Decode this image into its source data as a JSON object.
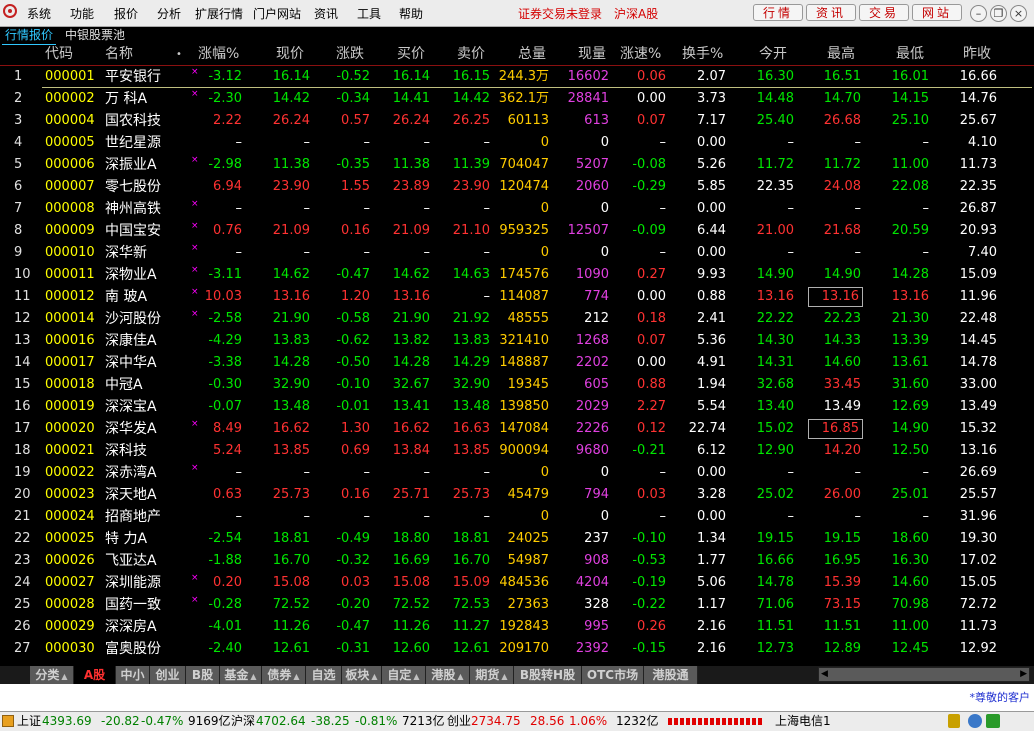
{
  "menubar": {
    "items": [
      "系统",
      "功能",
      "报价",
      "分析",
      "扩展行情",
      "门户网站",
      "资讯",
      "工具",
      "帮助"
    ],
    "status_text": "证券交易未登录",
    "market_text": "沪深A股",
    "buttons": [
      "行情",
      "资讯",
      "交易",
      "网站"
    ],
    "window_controls": [
      "minimize-icon",
      "restore-icon",
      "close-icon"
    ]
  },
  "top_tabs": [
    "行情报价",
    "中银股票池"
  ],
  "columns": [
    "代码",
    "名称",
    "•",
    "涨幅%",
    "现价",
    "涨跌",
    "买价",
    "卖价",
    "总量",
    "现量",
    "涨速%",
    "换手%",
    "今开",
    "最高",
    "最低",
    "昨收"
  ],
  "colors": {
    "up": "#ff3232",
    "down": "#00e600",
    "flat": "#ffffff",
    "code": "#ffff00",
    "volume": "#ffcc00",
    "current_vol": "#e040e0",
    "marker": "#ff00ff"
  },
  "rows": [
    {
      "i": "1",
      "code": "000001",
      "name": "平安银行",
      "m": true,
      "chg": "-3.12",
      "price": "16.14",
      "diff": "-0.52",
      "bid": "16.14",
      "ask": "16.15",
      "vol": "244.3万",
      "cur": "16602",
      "spd": "0.06",
      "turn": "2.07",
      "open": "16.30",
      "high": "16.51",
      "low": "16.01",
      "prev": "16.66"
    },
    {
      "i": "2",
      "code": "000002",
      "name": "万  科A",
      "m": true,
      "chg": "-2.30",
      "price": "14.42",
      "diff": "-0.34",
      "bid": "14.41",
      "ask": "14.42",
      "vol": "362.1万",
      "cur": "28841",
      "spd": "0.00",
      "turn": "3.73",
      "open": "14.48",
      "high": "14.70",
      "low": "14.15",
      "prev": "14.76"
    },
    {
      "i": "3",
      "code": "000004",
      "name": "国农科技",
      "m": false,
      "chg": "2.22",
      "price": "26.24",
      "diff": "0.57",
      "bid": "26.24",
      "ask": "26.25",
      "vol": "60113",
      "cur": "613",
      "spd": "0.07",
      "turn": "7.17",
      "open": "25.40",
      "high": "26.68",
      "low": "25.10",
      "prev": "25.67"
    },
    {
      "i": "4",
      "code": "000005",
      "name": "世纪星源",
      "m": false,
      "chg": "–",
      "price": "–",
      "diff": "–",
      "bid": "–",
      "ask": "–",
      "vol": "0",
      "cur": "0",
      "spd": "–",
      "turn": "0.00",
      "open": "–",
      "high": "–",
      "low": "–",
      "prev": "4.10"
    },
    {
      "i": "5",
      "code": "000006",
      "name": "深振业A",
      "m": true,
      "chg": "-2.98",
      "price": "11.38",
      "diff": "-0.35",
      "bid": "11.38",
      "ask": "11.39",
      "vol": "704047",
      "cur": "5207",
      "spd": "-0.08",
      "turn": "5.26",
      "open": "11.72",
      "high": "11.72",
      "low": "11.00",
      "prev": "11.73"
    },
    {
      "i": "6",
      "code": "000007",
      "name": "零七股份",
      "m": false,
      "chg": "6.94",
      "price": "23.90",
      "diff": "1.55",
      "bid": "23.89",
      "ask": "23.90",
      "vol": "120474",
      "cur": "2060",
      "spd": "-0.29",
      "turn": "5.85",
      "open": "22.35",
      "high": "24.08",
      "low": "22.08",
      "prev": "22.35"
    },
    {
      "i": "7",
      "code": "000008",
      "name": "神州高铁",
      "m": true,
      "chg": "–",
      "price": "–",
      "diff": "–",
      "bid": "–",
      "ask": "–",
      "vol": "0",
      "cur": "0",
      "spd": "–",
      "turn": "0.00",
      "open": "–",
      "high": "–",
      "low": "–",
      "prev": "26.87"
    },
    {
      "i": "8",
      "code": "000009",
      "name": "中国宝安",
      "m": true,
      "chg": "0.76",
      "price": "21.09",
      "diff": "0.16",
      "bid": "21.09",
      "ask": "21.10",
      "vol": "959325",
      "cur": "12507",
      "spd": "-0.09",
      "turn": "6.44",
      "open": "21.00",
      "high": "21.68",
      "low": "20.59",
      "prev": "20.93"
    },
    {
      "i": "9",
      "code": "000010",
      "name": "深华新",
      "m": true,
      "chg": "–",
      "price": "–",
      "diff": "–",
      "bid": "–",
      "ask": "–",
      "vol": "0",
      "cur": "0",
      "spd": "–",
      "turn": "0.00",
      "open": "–",
      "high": "–",
      "low": "–",
      "prev": "7.40"
    },
    {
      "i": "10",
      "code": "000011",
      "name": "深物业A",
      "m": true,
      "chg": "-3.11",
      "price": "14.62",
      "diff": "-0.47",
      "bid": "14.62",
      "ask": "14.63",
      "vol": "174576",
      "cur": "1090",
      "spd": "0.27",
      "turn": "9.93",
      "open": "14.90",
      "high": "14.90",
      "low": "14.28",
      "prev": "15.09"
    },
    {
      "i": "11",
      "code": "000012",
      "name": "南  玻A",
      "m": true,
      "chg": "10.03",
      "price": "13.16",
      "diff": "1.20",
      "bid": "13.16",
      "ask": "–",
      "vol": "114087",
      "cur": "774",
      "spd": "0.00",
      "turn": "0.88",
      "open": "13.16",
      "high": "13.16",
      "low": "13.16",
      "prev": "11.96"
    },
    {
      "i": "12",
      "code": "000014",
      "name": "沙河股份",
      "m": true,
      "chg": "-2.58",
      "price": "21.90",
      "diff": "-0.58",
      "bid": "21.90",
      "ask": "21.92",
      "vol": "48555",
      "cur": "212",
      "spd": "0.18",
      "turn": "2.41",
      "open": "22.22",
      "high": "22.23",
      "low": "21.30",
      "prev": "22.48"
    },
    {
      "i": "13",
      "code": "000016",
      "name": "深康佳A",
      "m": false,
      "chg": "-4.29",
      "price": "13.83",
      "diff": "-0.62",
      "bid": "13.82",
      "ask": "13.83",
      "vol": "321410",
      "cur": "1268",
      "spd": "0.07",
      "turn": "5.36",
      "open": "14.30",
      "high": "14.33",
      "low": "13.39",
      "prev": "14.45"
    },
    {
      "i": "14",
      "code": "000017",
      "name": "深中华A",
      "m": false,
      "chg": "-3.38",
      "price": "14.28",
      "diff": "-0.50",
      "bid": "14.28",
      "ask": "14.29",
      "vol": "148887",
      "cur": "2202",
      "spd": "0.00",
      "turn": "4.91",
      "open": "14.31",
      "high": "14.60",
      "low": "13.61",
      "prev": "14.78"
    },
    {
      "i": "15",
      "code": "000018",
      "name": "中冠A",
      "m": false,
      "chg": "-0.30",
      "price": "32.90",
      "diff": "-0.10",
      "bid": "32.67",
      "ask": "32.90",
      "vol": "19345",
      "cur": "605",
      "spd": "0.88",
      "turn": "1.94",
      "open": "32.68",
      "high": "33.45",
      "low": "31.60",
      "prev": "33.00"
    },
    {
      "i": "16",
      "code": "000019",
      "name": "深深宝A",
      "m": false,
      "chg": "-0.07",
      "price": "13.48",
      "diff": "-0.01",
      "bid": "13.41",
      "ask": "13.48",
      "vol": "139850",
      "cur": "2029",
      "spd": "2.27",
      "turn": "5.54",
      "open": "13.40",
      "high": "13.49",
      "low": "12.69",
      "prev": "13.49"
    },
    {
      "i": "17",
      "code": "000020",
      "name": "深华发A",
      "m": true,
      "chg": "8.49",
      "price": "16.62",
      "diff": "1.30",
      "bid": "16.62",
      "ask": "16.63",
      "vol": "147084",
      "cur": "2226",
      "spd": "0.12",
      "turn": "22.74",
      "open": "15.02",
      "high": "16.85",
      "low": "14.90",
      "prev": "15.32"
    },
    {
      "i": "18",
      "code": "000021",
      "name": "深科技",
      "m": false,
      "chg": "5.24",
      "price": "13.85",
      "diff": "0.69",
      "bid": "13.84",
      "ask": "13.85",
      "vol": "900094",
      "cur": "9680",
      "spd": "-0.21",
      "turn": "6.12",
      "open": "12.90",
      "high": "14.20",
      "low": "12.50",
      "prev": "13.16"
    },
    {
      "i": "19",
      "code": "000022",
      "name": "深赤湾A",
      "m": true,
      "chg": "–",
      "price": "–",
      "diff": "–",
      "bid": "–",
      "ask": "–",
      "vol": "0",
      "cur": "0",
      "spd": "–",
      "turn": "0.00",
      "open": "–",
      "high": "–",
      "low": "–",
      "prev": "26.69"
    },
    {
      "i": "20",
      "code": "000023",
      "name": "深天地A",
      "m": false,
      "chg": "0.63",
      "price": "25.73",
      "diff": "0.16",
      "bid": "25.71",
      "ask": "25.73",
      "vol": "45479",
      "cur": "794",
      "spd": "0.03",
      "turn": "3.28",
      "open": "25.02",
      "high": "26.00",
      "low": "25.01",
      "prev": "25.57"
    },
    {
      "i": "21",
      "code": "000024",
      "name": "招商地产",
      "m": false,
      "chg": "–",
      "price": "–",
      "diff": "–",
      "bid": "–",
      "ask": "–",
      "vol": "0",
      "cur": "0",
      "spd": "–",
      "turn": "0.00",
      "open": "–",
      "high": "–",
      "low": "–",
      "prev": "31.96"
    },
    {
      "i": "22",
      "code": "000025",
      "name": "特  力A",
      "m": false,
      "chg": "-2.54",
      "price": "18.81",
      "diff": "-0.49",
      "bid": "18.80",
      "ask": "18.81",
      "vol": "24025",
      "cur": "237",
      "spd": "-0.10",
      "turn": "1.34",
      "open": "19.15",
      "high": "19.15",
      "low": "18.60",
      "prev": "19.30"
    },
    {
      "i": "23",
      "code": "000026",
      "name": "飞亚达A",
      "m": false,
      "chg": "-1.88",
      "price": "16.70",
      "diff": "-0.32",
      "bid": "16.69",
      "ask": "16.70",
      "vol": "54987",
      "cur": "908",
      "spd": "-0.53",
      "turn": "1.77",
      "open": "16.66",
      "high": "16.95",
      "low": "16.30",
      "prev": "17.02"
    },
    {
      "i": "24",
      "code": "000027",
      "name": "深圳能源",
      "m": true,
      "chg": "0.20",
      "price": "15.08",
      "diff": "0.03",
      "bid": "15.08",
      "ask": "15.09",
      "vol": "484536",
      "cur": "4204",
      "spd": "-0.19",
      "turn": "5.06",
      "open": "14.78",
      "high": "15.39",
      "low": "14.60",
      "prev": "15.05"
    },
    {
      "i": "25",
      "code": "000028",
      "name": "国药一致",
      "m": true,
      "chg": "-0.28",
      "price": "72.52",
      "diff": "-0.20",
      "bid": "72.52",
      "ask": "72.53",
      "vol": "27363",
      "cur": "328",
      "spd": "-0.22",
      "turn": "1.17",
      "open": "71.06",
      "high": "73.15",
      "low": "70.98",
      "prev": "72.72"
    },
    {
      "i": "26",
      "code": "000029",
      "name": "深深房A",
      "m": false,
      "chg": "-4.01",
      "price": "11.26",
      "diff": "-0.47",
      "bid": "11.26",
      "ask": "11.27",
      "vol": "192843",
      "cur": "995",
      "spd": "0.26",
      "turn": "2.16",
      "open": "11.51",
      "high": "11.51",
      "low": "11.00",
      "prev": "11.73"
    },
    {
      "i": "27",
      "code": "000030",
      "name": "富奥股份",
      "m": false,
      "chg": "-2.40",
      "price": "12.61",
      "diff": "-0.31",
      "bid": "12.60",
      "ask": "12.61",
      "vol": "209170",
      "cur": "2392",
      "spd": "-0.15",
      "turn": "2.16",
      "open": "12.73",
      "high": "12.89",
      "low": "12.45",
      "prev": "12.92"
    }
  ],
  "bottom_tabs": [
    {
      "label": "分类",
      "arrow": true
    },
    {
      "label": "A股",
      "arrow": false,
      "active": true
    },
    {
      "label": "中小",
      "arrow": false
    },
    {
      "label": "创业",
      "arrow": false
    },
    {
      "label": "B股",
      "arrow": false
    },
    {
      "label": "基金",
      "arrow": true
    },
    {
      "label": "债券",
      "arrow": true
    },
    {
      "label": "自选",
      "arrow": false
    },
    {
      "label": "板块",
      "arrow": true
    },
    {
      "label": "自定",
      "arrow": true
    },
    {
      "label": "港股",
      "arrow": true
    },
    {
      "label": "期货",
      "arrow": true
    },
    {
      "label": "B股转H股",
      "arrow": false
    },
    {
      "label": "OTC市场",
      "arrow": false
    },
    {
      "label": "港股通",
      "arrow": false
    }
  ],
  "ad_text": "*尊敬的客户",
  "statusbar": {
    "sh_label": "上证",
    "sh_index": "4393.69",
    "sh_chg": "-20.82",
    "sh_pct": "-0.47%",
    "sh_amt": "9169亿",
    "hs_label": "沪深",
    "hs_index": "4702.64",
    "hs_chg": "-38.25",
    "hs_pct": "-0.81%",
    "hs_amt": "7213亿",
    "cy_label": "创业",
    "cy_index": "2734.75",
    "cy_chg": "28.56",
    "cy_pct": "1.06%",
    "cy_amt": "1232亿",
    "server": "上海电信1"
  }
}
